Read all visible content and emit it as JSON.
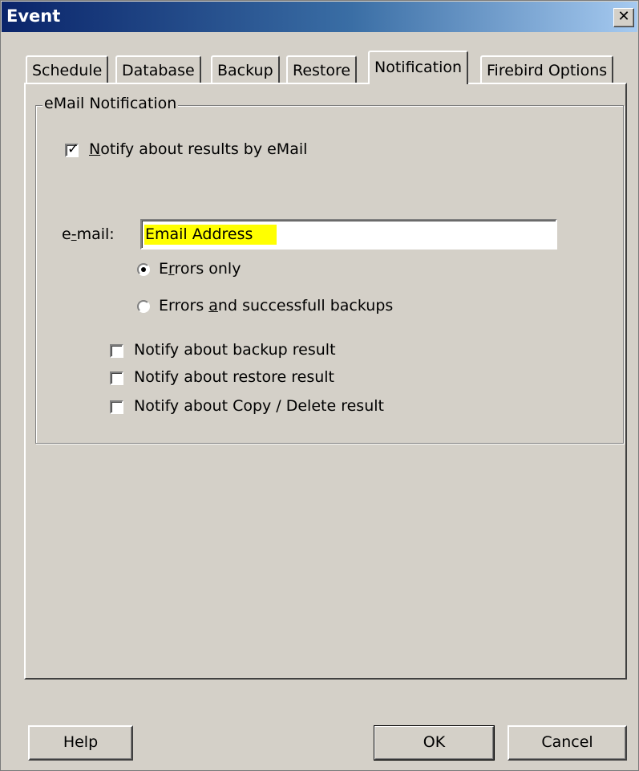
{
  "window": {
    "title": "Event"
  },
  "tabs": [
    {
      "label": "Schedule"
    },
    {
      "label": "Database"
    },
    {
      "label": "Backup"
    },
    {
      "label": "Restore"
    },
    {
      "label": "Notification"
    },
    {
      "label": "Firebird Options"
    }
  ],
  "active_tab": "Notification",
  "group": {
    "title": "eMail Notification",
    "notify_checkbox": {
      "label_first": "N",
      "label_rest": "otify about results by eMail",
      "checked": true
    },
    "email": {
      "label_a": "e",
      "label_b": "-",
      "label_c": "mail:",
      "value": "Email Address"
    },
    "radio_errors_only": {
      "label_a": "E",
      "label_b": "r",
      "label_c": "rors only",
      "selected": true
    },
    "radio_errors_success": {
      "label_a": "Errors ",
      "label_b": "a",
      "label_c": "nd successfull backups",
      "selected": false
    },
    "options": [
      {
        "label": "Notify about backup result",
        "checked": false
      },
      {
        "label": "Notify about restore result",
        "checked": false
      },
      {
        "label": "Notify about Copy / Delete result",
        "checked": false
      }
    ]
  },
  "buttons": {
    "help": "Help",
    "ok": "OK",
    "cancel": "Cancel"
  },
  "colors": {
    "title_bar": "#0a246a",
    "highlight": "#ffff00",
    "face": "#d4d0c8"
  }
}
